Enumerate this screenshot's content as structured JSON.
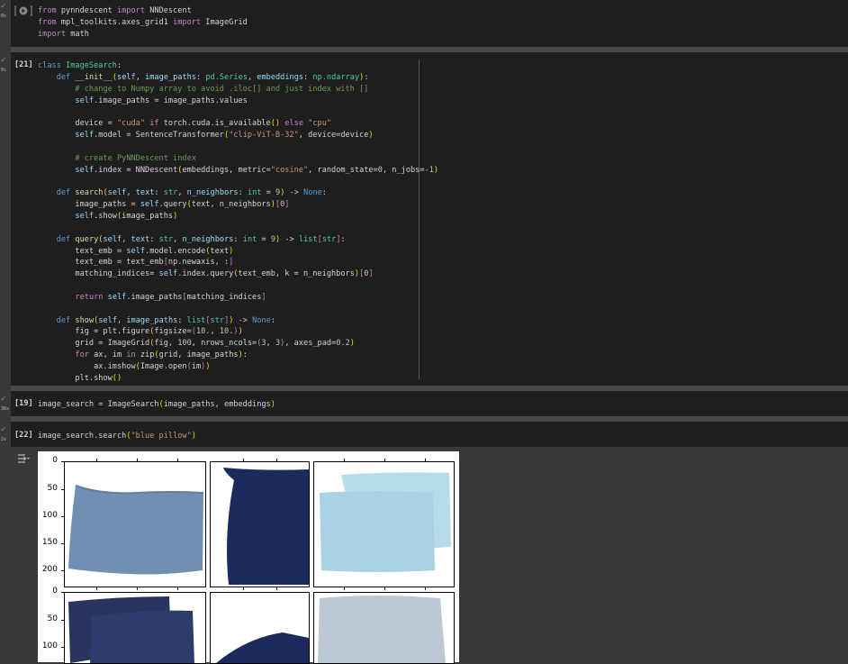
{
  "cells": [
    {
      "exec": "",
      "time": "0s",
      "lines": [
        "from pynndescent import NNDescent",
        "from mpl_toolkits.axes_grid1 import ImageGrid",
        "import math"
      ]
    },
    {
      "exec": "[21]",
      "time": "0s"
    },
    {
      "exec": "[19]",
      "time": "36s",
      "lines": [
        "image_search = ImageSearch(image_paths, embeddings)"
      ]
    },
    {
      "exec": "[22]",
      "time": "2s",
      "lines": [
        "image_search.search(\"blue pillow\")"
      ]
    }
  ],
  "figure": {
    "yticks_row1": [
      "0",
      "50",
      "100",
      "150",
      "200"
    ],
    "yticks_row2": [
      "0",
      "50",
      "100"
    ],
    "colors": {
      "steel_blue": "#6f8fb3",
      "navy": "#1c2a5e",
      "light_blue": "#a9d3e3",
      "slate": "#27355f",
      "gray_blue": "#bcc9d4"
    }
  },
  "icons": [
    "play-run-icon",
    "output-toggle-icon",
    "check-icon"
  ]
}
